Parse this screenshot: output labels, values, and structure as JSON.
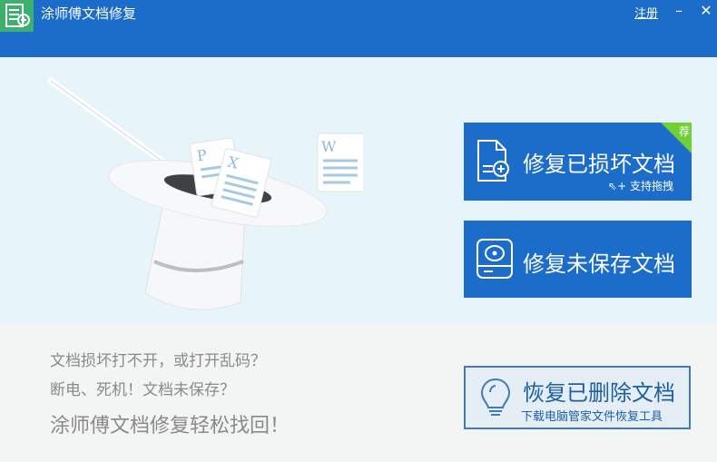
{
  "window": {
    "title": "涂师傅文档修复",
    "register_label": "注册",
    "minimize_glyph": "–",
    "close_glyph": "✕"
  },
  "hero": {
    "file_letters": [
      "P",
      "X",
      "W"
    ]
  },
  "actions": {
    "repair": {
      "label": "修复已损坏文档",
      "hint": "支持拖拽",
      "badge": "荐",
      "icon": "document-repair-icon"
    },
    "unsaved": {
      "label": "修复未保存文档",
      "icon": "hard-drive-icon"
    },
    "recover": {
      "label": "恢复已删除文档",
      "sub": "下载电脑管家文件恢复工具",
      "icon": "lightbulb-icon"
    }
  },
  "taglines": {
    "line1": "文档损坏打不开，或打开乱码？",
    "line2": "断电、死机！文档未保存？",
    "line3": "涂师傅文档修复轻松找回！"
  },
  "colors": {
    "primary": "#1c6cc9",
    "logo": "#3daf6e",
    "badge": "#6fcf34",
    "hero_bg": "#e7f4fa"
  }
}
